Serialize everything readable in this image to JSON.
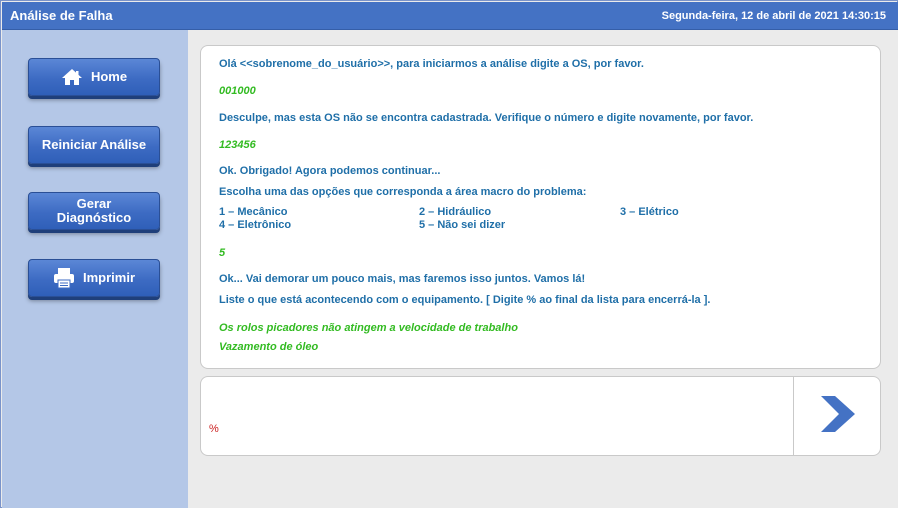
{
  "window": {
    "title": "Análise de Falha",
    "datetime": "Segunda-feira, 12 de abril de 2021 14:30:15"
  },
  "sidebar": {
    "home_label": "Home",
    "restart_label": "Reiniciar Análise",
    "diagnosis_label_1": "Gerar",
    "diagnosis_label_2": "Diagnóstico",
    "print_label": "Imprimir"
  },
  "chat": {
    "greeting": "Olá <<sobrenome_do_usuário>>, para iniciarmos a análise digite a OS, por favor.",
    "user_os_1": "001000",
    "not_found": "Desculpe, mas esta OS não se encontra cadastrada. Verifique o número e digite novamente, por favor.",
    "user_os_2": "123456",
    "thanks": "Ok. Obrigado! Agora podemos continuar...",
    "choose": "Escolha uma das opções que corresponda a área macro do problema:",
    "options": [
      "1 – Mecânico",
      "2 – Hidráulico",
      "3 – Elétrico",
      "4 – Eletrônico",
      "5 – Não sei dizer"
    ],
    "user_choice": "5",
    "slow": "Ok... Vai demorar um pouco mais, mas faremos isso juntos. Vamos lá!",
    "list_prompt": "Liste o que está acontecendo com o equipamento. [ Digite % ao final da lista para encerrá-la ].",
    "user_items": [
      "Os rolos picadores não atingem a velocidade de trabalho",
      "Vazamento de óleo"
    ]
  },
  "input": {
    "value": "%"
  },
  "colors": {
    "titlebar": "#4472c4",
    "sidebar": "#b4c7e7",
    "system_text": "#1f6fa8",
    "user_text": "#33bb22",
    "send_arrow": "#4472c4"
  },
  "icons": {
    "home": "home-icon",
    "print": "printer-icon",
    "send": "send-arrow-icon"
  }
}
